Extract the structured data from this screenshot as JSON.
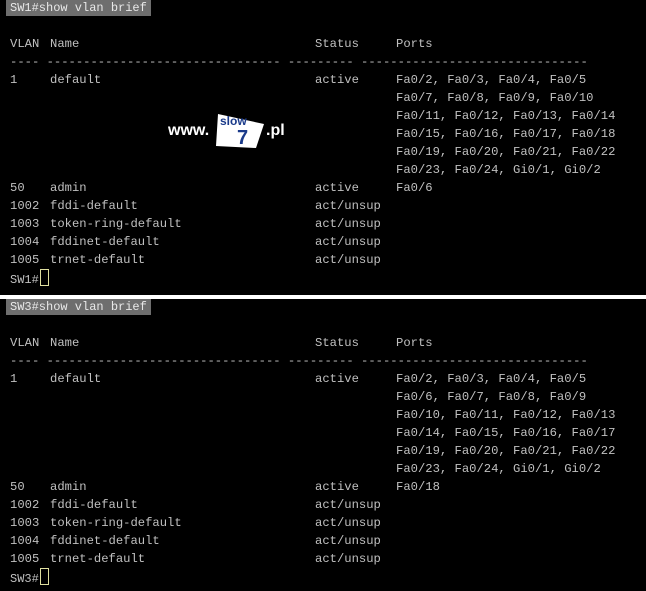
{
  "sw1": {
    "command": "SW1#show vlan brief",
    "headers": {
      "vlan": "VLAN",
      "name": "Name",
      "status": "Status",
      "ports": "Ports"
    },
    "separator": "---- -------------------------------- --------- -------------------------------",
    "rows": [
      {
        "vlan": "1",
        "name": "default",
        "status": "active",
        "ports": [
          "Fa0/2, Fa0/3, Fa0/4, Fa0/5",
          "Fa0/7, Fa0/8, Fa0/9, Fa0/10",
          "Fa0/11, Fa0/12, Fa0/13, Fa0/14",
          "Fa0/15, Fa0/16, Fa0/17, Fa0/18",
          "Fa0/19, Fa0/20, Fa0/21, Fa0/22",
          "Fa0/23, Fa0/24, Gi0/1, Gi0/2"
        ]
      },
      {
        "vlan": "50",
        "name": "admin",
        "status": "active",
        "ports": [
          "Fa0/6"
        ]
      },
      {
        "vlan": "1002",
        "name": "fddi-default",
        "status": "act/unsup",
        "ports": []
      },
      {
        "vlan": "1003",
        "name": "token-ring-default",
        "status": "act/unsup",
        "ports": []
      },
      {
        "vlan": "1004",
        "name": "fddinet-default",
        "status": "act/unsup",
        "ports": []
      },
      {
        "vlan": "1005",
        "name": "trnet-default",
        "status": "act/unsup",
        "ports": []
      }
    ],
    "prompt": "SW1#"
  },
  "sw3": {
    "command": "SW3#show vlan brief",
    "headers": {
      "vlan": "VLAN",
      "name": "Name",
      "status": "Status",
      "ports": "Ports"
    },
    "separator": "---- -------------------------------- --------- -------------------------------",
    "rows": [
      {
        "vlan": "1",
        "name": "default",
        "status": "active",
        "ports": [
          "Fa0/2, Fa0/3, Fa0/4, Fa0/5",
          "Fa0/6, Fa0/7, Fa0/8, Fa0/9",
          "Fa0/10, Fa0/11, Fa0/12, Fa0/13",
          "Fa0/14, Fa0/15, Fa0/16, Fa0/17",
          "Fa0/19, Fa0/20, Fa0/21, Fa0/22",
          "Fa0/23, Fa0/24, Gi0/1, Gi0/2"
        ]
      },
      {
        "vlan": "50",
        "name": "admin",
        "status": "active",
        "ports": [
          "Fa0/18"
        ]
      },
      {
        "vlan": "1002",
        "name": "fddi-default",
        "status": "act/unsup",
        "ports": []
      },
      {
        "vlan": "1003",
        "name": "token-ring-default",
        "status": "act/unsup",
        "ports": []
      },
      {
        "vlan": "1004",
        "name": "fddinet-default",
        "status": "act/unsup",
        "ports": []
      },
      {
        "vlan": "1005",
        "name": "trnet-default",
        "status": "act/unsup",
        "ports": []
      }
    ],
    "prompt": "SW3#"
  },
  "watermark": {
    "prefix": "www.",
    "brand_top": "slow",
    "brand_num": "7",
    "suffix": ".pl"
  },
  "colors": {
    "background": "#000000",
    "text": "#c0c0c0",
    "command_bar": "#6e6e6e",
    "divider": "#ffffff"
  }
}
